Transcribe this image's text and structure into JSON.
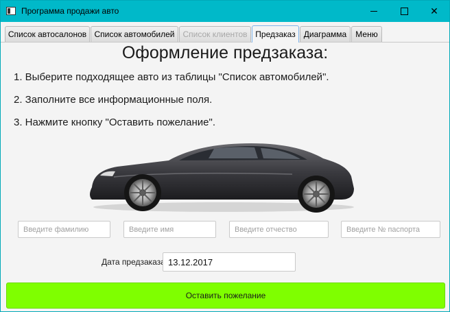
{
  "window": {
    "title": "Программа продажи авто",
    "controls": {
      "minimize_icon": "minimize-icon",
      "maximize_icon": "maximize-icon",
      "close_icon": "close-icon",
      "close_glyph": "✕"
    }
  },
  "tabs": [
    {
      "label": "Список автосалонов",
      "state": "normal"
    },
    {
      "label": "Список автомобилей",
      "state": "normal"
    },
    {
      "label": "Список клиентов",
      "state": "disabled"
    },
    {
      "label": "Предзаказ",
      "state": "active"
    },
    {
      "label": "Диаграмма",
      "state": "normal"
    },
    {
      "label": "Меню",
      "state": "normal"
    }
  ],
  "main": {
    "heading": "Оформление предзаказа:",
    "steps": [
      "1. Выберите подходящее авто из таблицы \"Список автомобилей\".",
      "2. Заполните все информационные поля.",
      "3. Нажмите кнопку \"Оставить пожелание\"."
    ],
    "image": "car-image",
    "fields": {
      "surname_placeholder": "Введите фамилию",
      "name_placeholder": "Введите имя",
      "patronymic_placeholder": "Введите отчество",
      "passport_placeholder": "Введите № паспорта"
    },
    "date_label": "Дата предзаказа",
    "date_value": "13.12.2017",
    "submit_label": "Оставить пожелание"
  },
  "colors": {
    "titlebar": "#00B9C9",
    "submit_button": "#7FFF00",
    "window_bg": "#F4F4F4"
  }
}
